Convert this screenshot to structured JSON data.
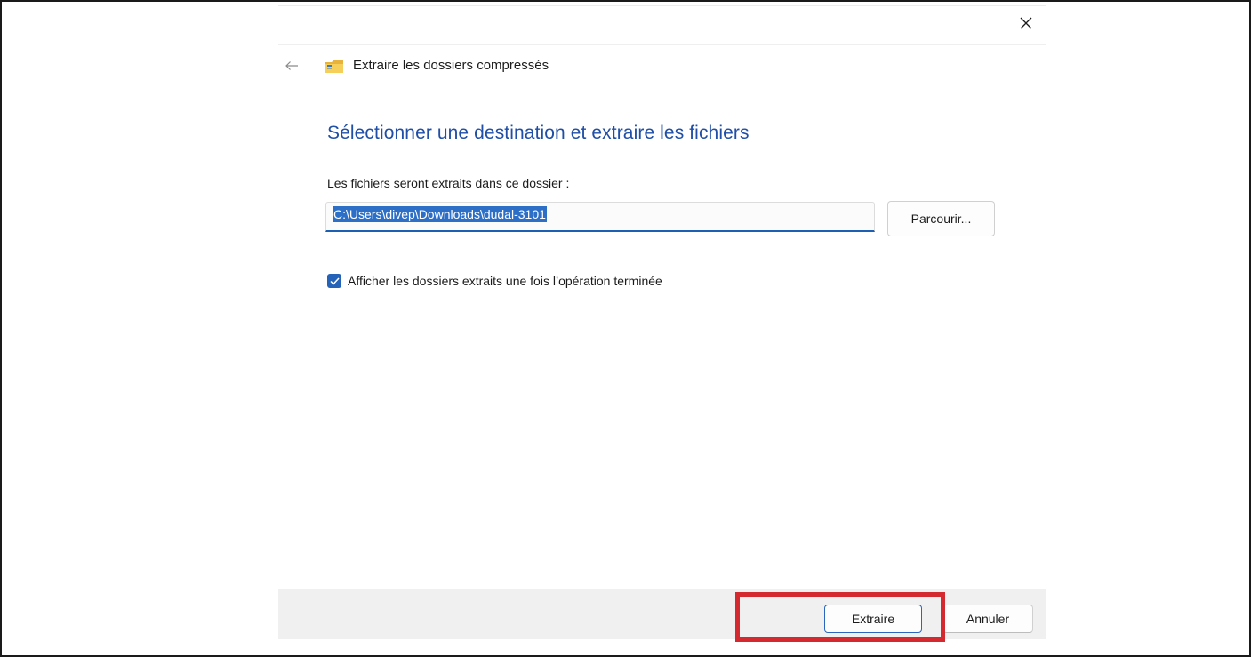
{
  "dialog": {
    "title": "Extraire les dossiers compressés",
    "heading": "Sélectionner une destination et extraire les fichiers",
    "field_label": "Les fichiers seront extraits dans ce dossier :",
    "destination_path": "C:\\Users\\divep\\Downloads\\dudal-3101",
    "browse_label": "Parcourir...",
    "show_folders_label": "Afficher les dossiers extraits une fois l’opération terminée",
    "show_folders_checked": true
  },
  "footer": {
    "extract_label": "Extraire",
    "cancel_label": "Annuler"
  },
  "icons": {
    "close": "close-icon",
    "back": "back-arrow-icon",
    "folder": "zip-folder-icon",
    "check": "checkmark-icon"
  },
  "colors": {
    "heading": "#1f4fa6",
    "accent": "#2563b8",
    "selection": "#2d6fc7",
    "highlight": "#d42a2f",
    "footer_bg": "#f0f0f0"
  }
}
